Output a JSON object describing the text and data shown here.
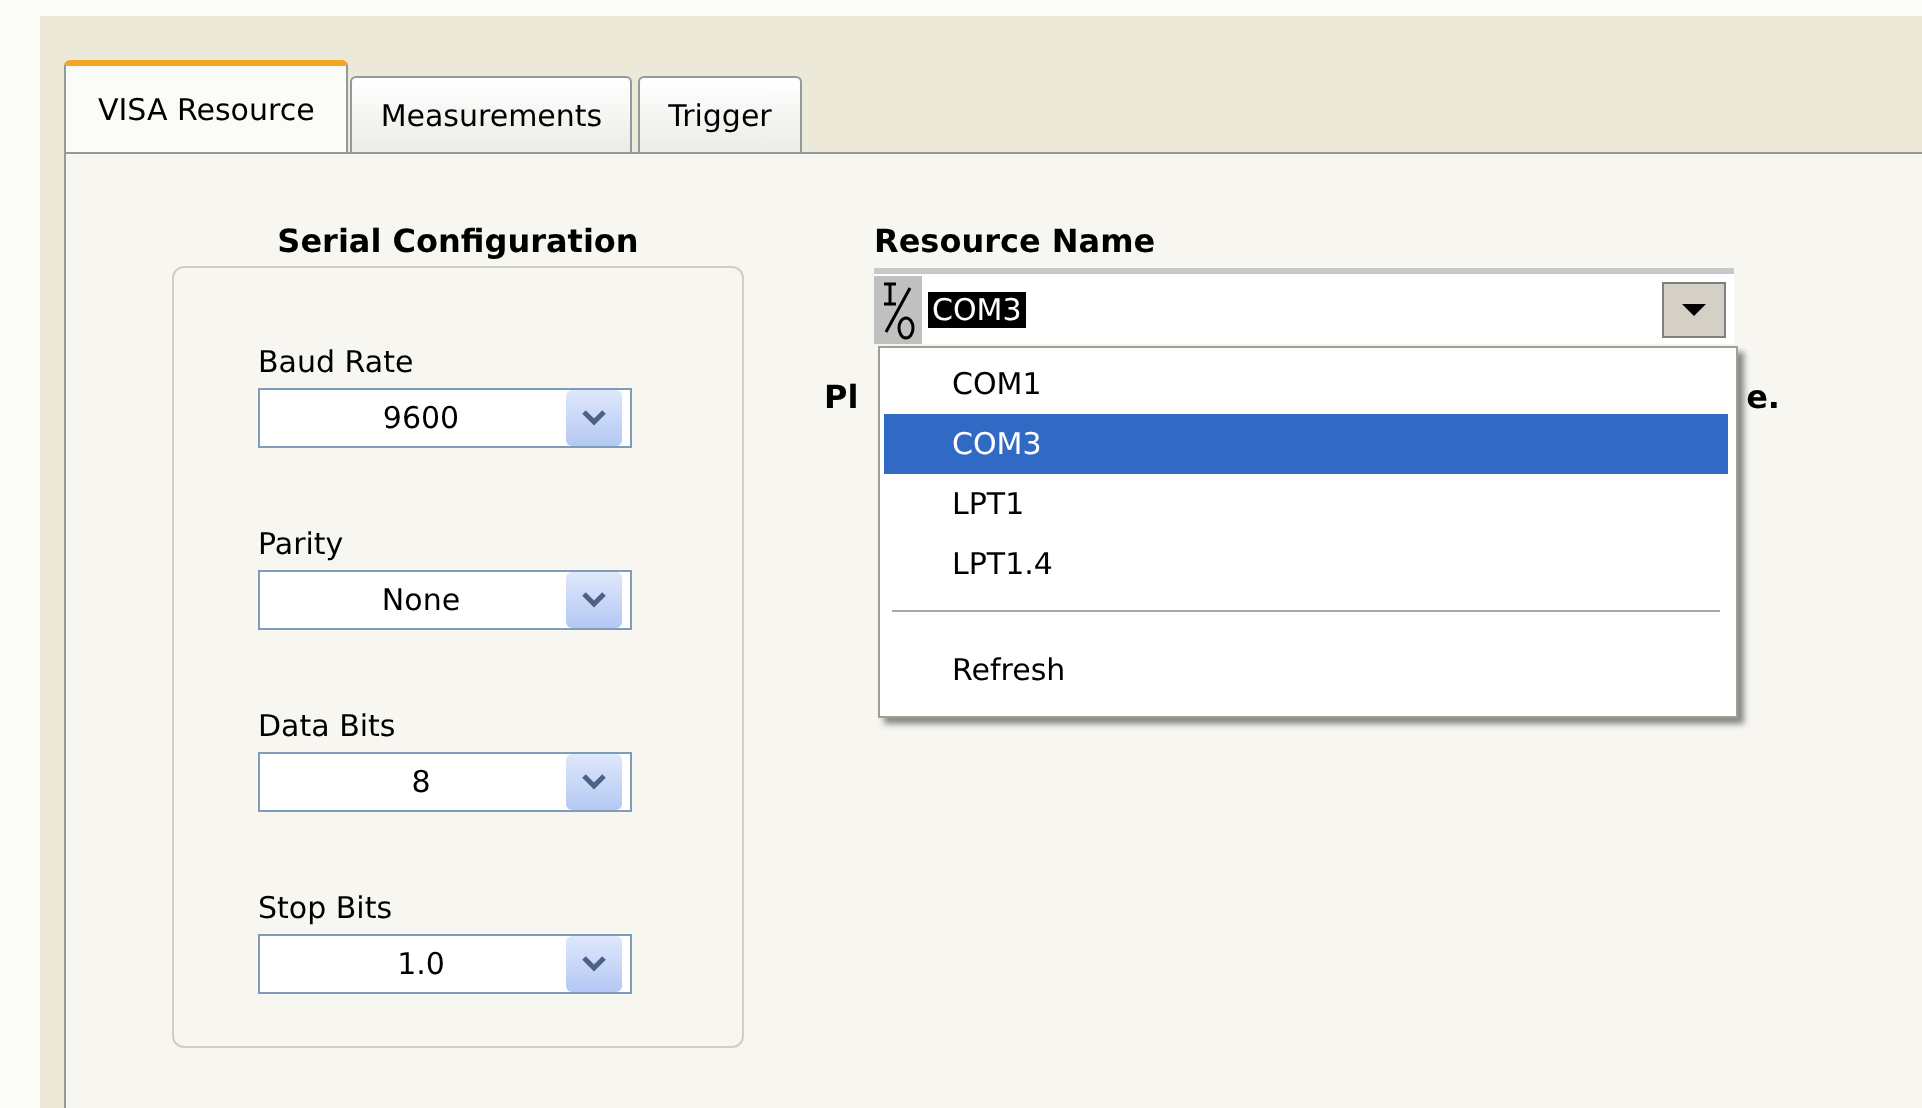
{
  "tabs": [
    {
      "label": "VISA Resource",
      "selected": true
    },
    {
      "label": "Measurements",
      "selected": false
    },
    {
      "label": "Trigger",
      "selected": false
    }
  ],
  "serial_configuration": {
    "title": "Serial Configuration",
    "fields": [
      {
        "label": "Baud Rate",
        "value": "9600"
      },
      {
        "label": "Parity",
        "value": "None"
      },
      {
        "label": "Data Bits",
        "value": "8"
      },
      {
        "label": "Stop Bits",
        "value": "1.0"
      }
    ]
  },
  "resource_name": {
    "label": "Resource Name",
    "value": "COM3",
    "hint_left": "Pl",
    "hint_right": "e.",
    "menu": {
      "expanded": true,
      "items": [
        {
          "kind": "item",
          "label": "COM1",
          "selected": false
        },
        {
          "kind": "item",
          "label": "COM3",
          "selected": true
        },
        {
          "kind": "item",
          "label": "LPT1",
          "selected": false
        },
        {
          "kind": "item",
          "label": "LPT1.4",
          "selected": false
        },
        {
          "kind": "separator"
        },
        {
          "kind": "item",
          "label": "Refresh",
          "selected": false
        }
      ]
    }
  }
}
